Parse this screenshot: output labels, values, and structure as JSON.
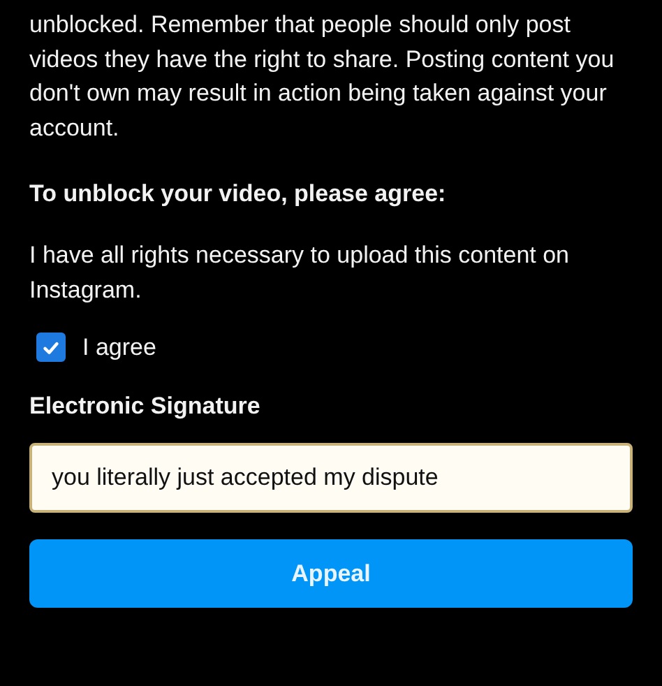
{
  "notice": "unblocked. Remember that people should only post videos they have the right to share. Posting content you don't own may result in action being taken against your account.",
  "agree_heading": "To unblock your video, please agree:",
  "statement": "I have all rights necessary to upload this content on Instagram.",
  "agreement": {
    "label": "I agree",
    "checked": true
  },
  "signature": {
    "label": "Electronic Signature",
    "value": "you literally just accepted my dispute"
  },
  "buttons": [
    "Appeal"
  ]
}
